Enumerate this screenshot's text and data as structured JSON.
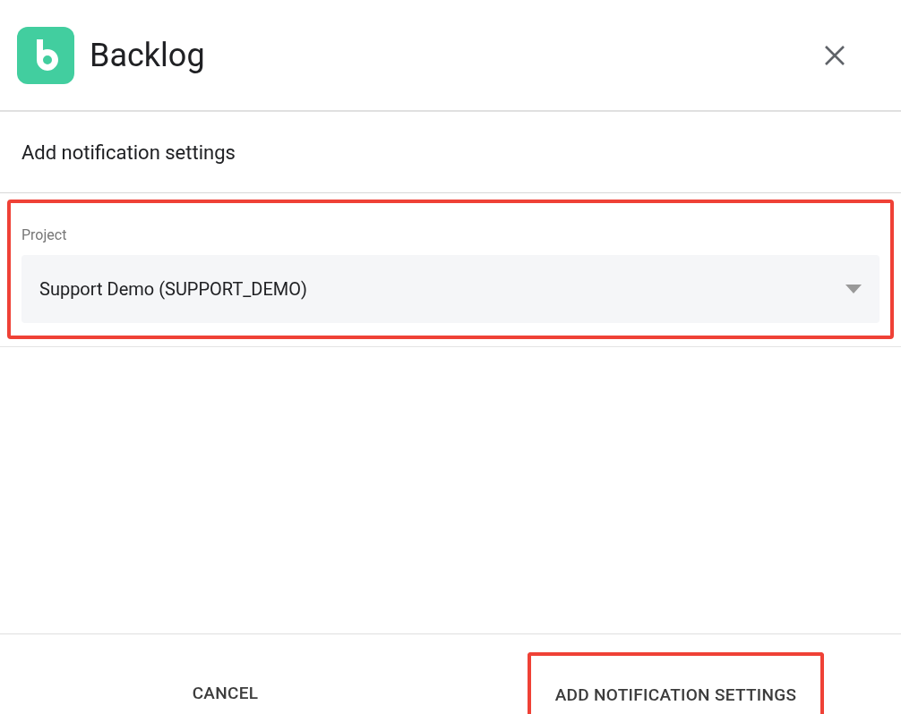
{
  "header": {
    "app_name": "Backlog"
  },
  "dialog": {
    "title": "Add notification settings"
  },
  "project_field": {
    "label": "Project",
    "value": "Support Demo (SUPPORT_DEMO)",
    "highlighted": true
  },
  "buttons": [
    {
      "label": "CANCEL",
      "highlighted": false
    },
    {
      "label": "ADD NOTIFICATION SETTINGS",
      "highlighted": true
    }
  ]
}
